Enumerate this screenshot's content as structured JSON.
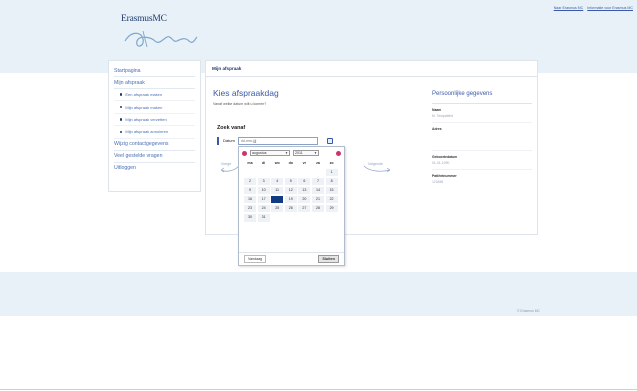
{
  "header": {
    "links": [
      "Naar Erasmus MC",
      "Informatie voor Erasmus MC"
    ],
    "logo_text": "ErasmusMC",
    "logo_script": "Zafung"
  },
  "sidebar": {
    "items": [
      {
        "label": "Startpagina"
      },
      {
        "label": "Mijn afspraak"
      }
    ],
    "subitems": [
      {
        "label": "Een afspraak maken"
      },
      {
        "label": "Mijn afspraak maken"
      },
      {
        "label": "Mijn afspraak verzetten"
      },
      {
        "label": "Mijn afspraak annuleren"
      }
    ],
    "bottom_items": [
      {
        "label": "Wijzig contactgegevens"
      },
      {
        "label": "Veel gestelde vragen"
      },
      {
        "label": "Uitloggen"
      }
    ]
  },
  "main": {
    "breadcrumb": "Mijn afspraak",
    "title": "Kies afspraakdag",
    "subtitle": "Vanaf welke datum wilt u komen?",
    "kies_label": "Zoek vanaf",
    "date_label": "Datum",
    "date_placeholder": "dd-mm-jjjj",
    "prev_label": "Vorige",
    "next_label": "Volgende"
  },
  "personal": {
    "title": "Persoonlijke gegevens",
    "fields": [
      {
        "label": "Naam",
        "value": "M. Testpatiënt"
      },
      {
        "label": "Adres",
        "value": ""
      },
      {
        "label": "Geboortedatum",
        "value": "01-01-1990"
      },
      {
        "label": "Patiëntnummer",
        "value": "123456"
      }
    ]
  },
  "calendar": {
    "month": "augustus",
    "year": "2011",
    "weekdays": [
      "ma",
      "di",
      "wo",
      "do",
      "vr",
      "za",
      "zo"
    ],
    "leading_empty": 6,
    "days": [
      "1",
      "2",
      "3",
      "4",
      "5",
      "6",
      "7",
      "8",
      "9",
      "10",
      "11",
      "12",
      "13",
      "14",
      "15",
      "16",
      "17",
      "18",
      "19",
      "20",
      "21",
      "22",
      "23",
      "24",
      "25",
      "26",
      "27",
      "28",
      "29",
      "30",
      "31"
    ],
    "selected_day": "18",
    "today_label": "Vandaag",
    "close_label": "Sluiten"
  },
  "footer": {
    "copyright": "© Erasmus MC"
  }
}
